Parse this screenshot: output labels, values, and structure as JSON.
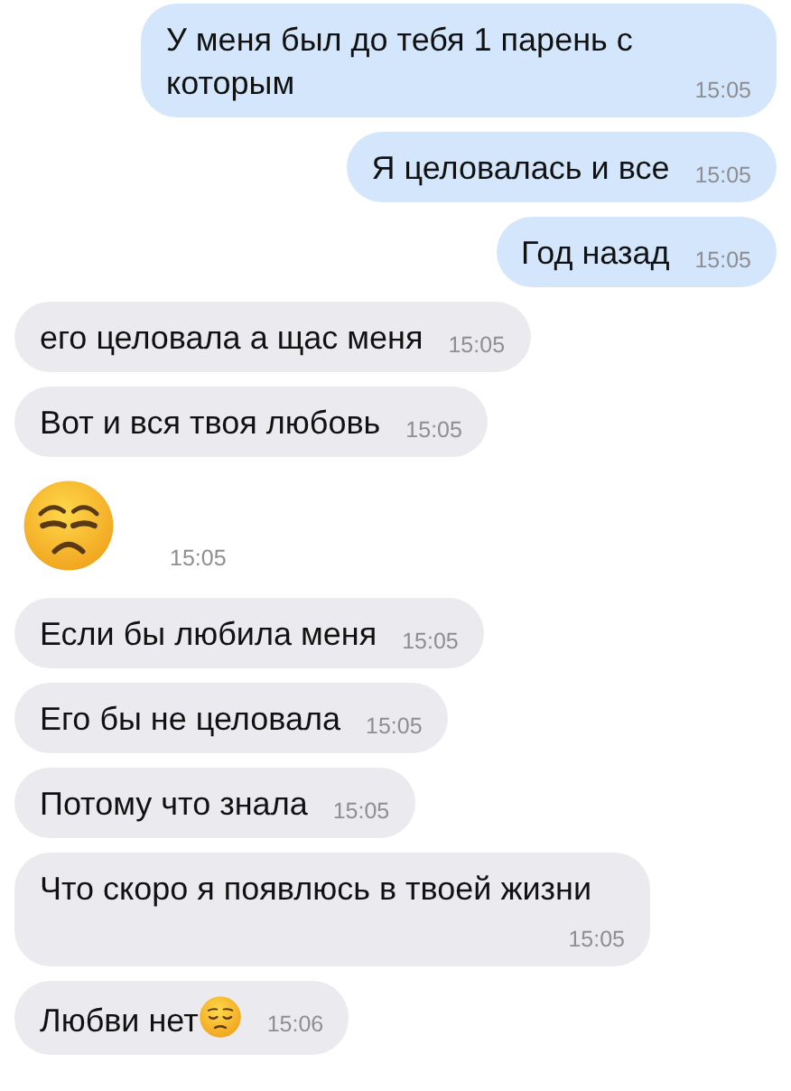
{
  "messages": [
    {
      "outgoing": true,
      "kind": "text",
      "text": "У меня был до тебя 1 парень с которым",
      "time": "15:05"
    },
    {
      "outgoing": true,
      "kind": "text",
      "text": "Я целовалась и все",
      "time": "15:05"
    },
    {
      "outgoing": true,
      "kind": "text",
      "text": "Год назад",
      "time": "15:05"
    },
    {
      "outgoing": false,
      "kind": "text",
      "text": "его целовала а щас меня",
      "time": "15:05"
    },
    {
      "outgoing": false,
      "kind": "text",
      "text": "Вот и вся твоя любовь",
      "time": "15:05"
    },
    {
      "outgoing": false,
      "kind": "emoji",
      "time": "15:05"
    },
    {
      "outgoing": false,
      "kind": "text",
      "text": "Если бы любила меня",
      "time": "15:05"
    },
    {
      "outgoing": false,
      "kind": "text",
      "text": "Его бы не целовала",
      "time": "15:05"
    },
    {
      "outgoing": false,
      "kind": "text",
      "text": "Потому что знала",
      "time": "15:05"
    },
    {
      "outgoing": false,
      "kind": "text",
      "text": "Что скоро я появлюсь в твоей жизни",
      "time": "15:05"
    },
    {
      "outgoing": false,
      "kind": "text_emoji",
      "text": "Любви нет",
      "time": "15:06"
    }
  ]
}
